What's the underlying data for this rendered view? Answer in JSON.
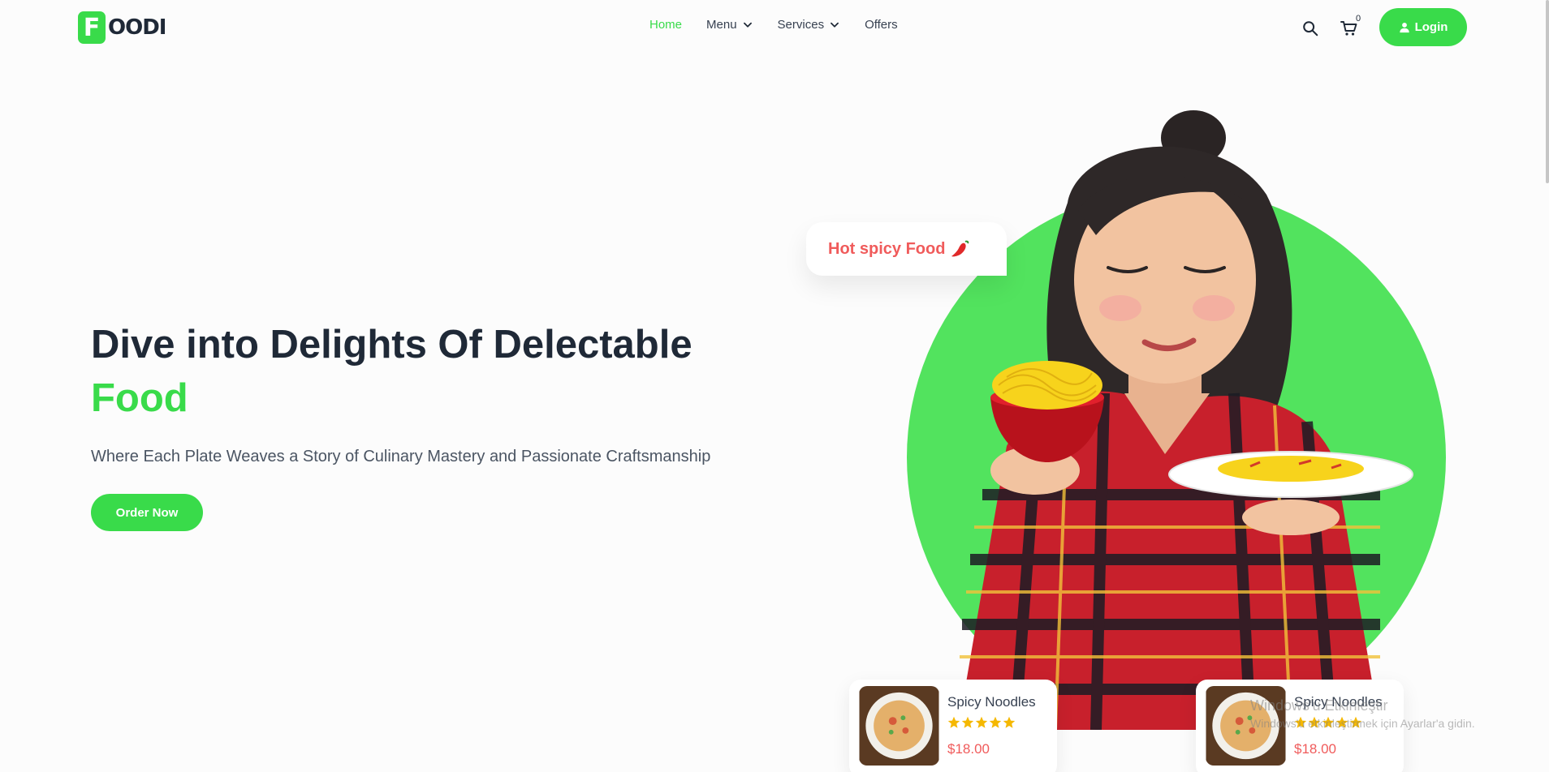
{
  "brand": {
    "mark": "F",
    "rest": "OODI",
    "accent_color": "#39db4a"
  },
  "nav": {
    "items": [
      {
        "label": "Home",
        "active": true,
        "dropdown": false
      },
      {
        "label": "Menu",
        "active": false,
        "dropdown": true
      },
      {
        "label": "Services",
        "active": false,
        "dropdown": true
      },
      {
        "label": "Offers",
        "active": false,
        "dropdown": false
      }
    ],
    "cart_count": "0",
    "login_label": "Login"
  },
  "hero": {
    "title_line1": "Dive into Delights Of Delectable",
    "title_accent": "Food",
    "subtitle": "Where Each Plate Weaves a Story of Culinary Mastery and Passionate Craftsmanship",
    "cta_label": "Order Now",
    "bubble_text": "Hot spicy Food"
  },
  "cards": [
    {
      "name": "Spicy Noodles",
      "rating": 5,
      "price": "$18.00"
    },
    {
      "name": "Spicy Noodles",
      "rating": 5,
      "price": "$18.00"
    }
  ],
  "overlay": {
    "line1": "Windows'u Etkinleştir",
    "line2": "Windows'u etkinleştirmek için Ayarlar'a gidin."
  },
  "colors": {
    "green": "#39db4a",
    "circle": "#52e35e",
    "price": "#f05b5b",
    "star": "#f5b800"
  }
}
